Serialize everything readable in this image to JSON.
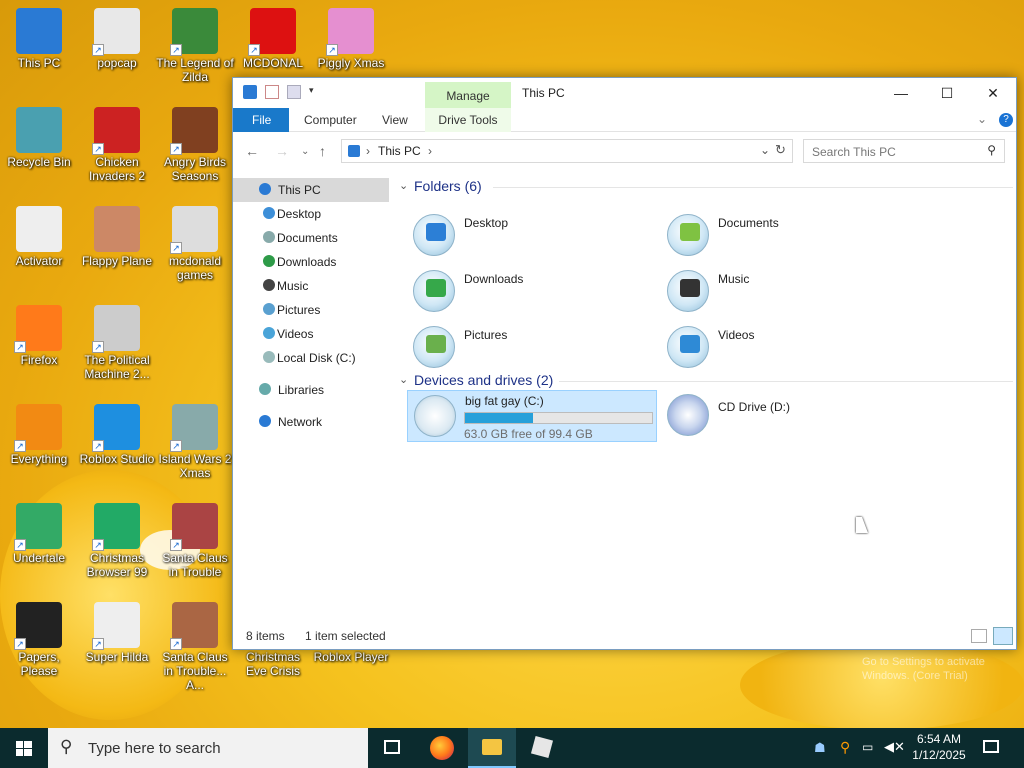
{
  "desktop": {
    "icons": [
      {
        "label": "This PC"
      },
      {
        "label": "popcap"
      },
      {
        "label": "The Legend of Zilda"
      },
      {
        "label": "MCDONAL"
      },
      {
        "label": "Piggly Xmas"
      },
      {
        "label": "Recycle Bin"
      },
      {
        "label": "Chicken Invaders 2"
      },
      {
        "label": "Angry Birds Seasons"
      },
      {
        "label": "Activator"
      },
      {
        "label": "Flappy Plane"
      },
      {
        "label": "mcdonald games"
      },
      {
        "label": "Firefox"
      },
      {
        "label": "The Political Machine 2..."
      },
      {
        "label": "Everything"
      },
      {
        "label": "Roblox Studio"
      },
      {
        "label": "Island Wars 2 Xmas"
      },
      {
        "label": "Undertale"
      },
      {
        "label": "Christmas Browser 99"
      },
      {
        "label": "Santa Claus in Trouble"
      },
      {
        "label": "Papers, Please"
      },
      {
        "label": "Super Hilda"
      },
      {
        "label": "Santa Claus in Trouble... A..."
      },
      {
        "label": "Christmas Eve Crisis"
      },
      {
        "label": "Roblox Player"
      }
    ],
    "watermark": {
      "line1": "Go to Settings to activate",
      "line2": "Windows. (Core Trial)"
    }
  },
  "window": {
    "title": "This PC",
    "manage_label": "Manage",
    "controls": {
      "minimize": "—",
      "maximize": "☐",
      "close": "✕"
    },
    "ribbon": {
      "file": "File",
      "computer": "Computer",
      "view": "View",
      "drive_tools": "Drive Tools"
    },
    "address": {
      "path": "This PC",
      "sep": "›"
    },
    "search": {
      "placeholder": "Search This PC"
    },
    "nav": [
      {
        "label": "This PC",
        "color": "#2a7ad4"
      },
      {
        "label": "Desktop",
        "color": "#3d8fd8"
      },
      {
        "label": "Documents",
        "color": "#8aa"
      },
      {
        "label": "Downloads",
        "color": "#2e9b48"
      },
      {
        "label": "Music",
        "color": "#444"
      },
      {
        "label": "Pictures",
        "color": "#5aa0d0"
      },
      {
        "label": "Videos",
        "color": "#4aa4d8"
      },
      {
        "label": "Local Disk (C:)",
        "color": "#9bb"
      },
      {
        "label": "Libraries",
        "color": "#6aa"
      },
      {
        "label": "Network",
        "color": "#2a7ad4"
      }
    ],
    "folders_header": "Folders (6)",
    "folders": [
      {
        "name": "Desktop",
        "color": "#2c7fd6"
      },
      {
        "name": "Documents",
        "color": "#7fc242"
      },
      {
        "name": "Downloads",
        "color": "#36a84a"
      },
      {
        "name": "Music",
        "color": "#333333"
      },
      {
        "name": "Pictures",
        "color": "#6ab04c"
      },
      {
        "name": "Videos",
        "color": "#2e8ad6"
      }
    ],
    "drives_header": "Devices and drives (2)",
    "drives": [
      {
        "name": "big fat gay (C:)",
        "free": "63.0 GB free of 99.4 GB",
        "used_fraction": 0.366
      },
      {
        "name": "CD Drive (D:)"
      }
    ],
    "status": {
      "items": "8 items",
      "selected": "1 item selected"
    }
  },
  "taskbar": {
    "search_placeholder": "Type here to search",
    "time": "6:54 AM",
    "date": "1/12/2025"
  }
}
